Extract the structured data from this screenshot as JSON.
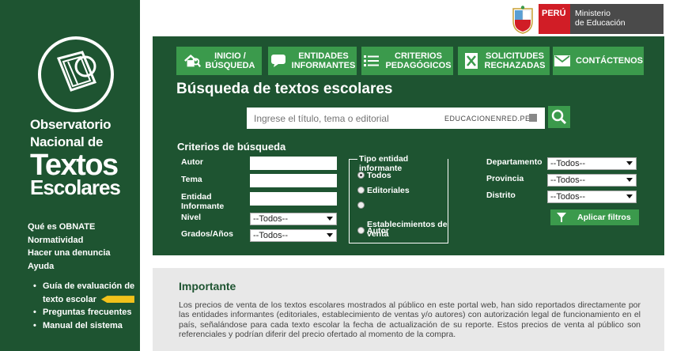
{
  "sidebar": {
    "logo": {
      "line1": "Observatorio",
      "line2": "Nacional de",
      "line3": "Textos",
      "line4": "Escolares"
    },
    "links": [
      {
        "label": "Qué es OBNATE"
      },
      {
        "label": "Normatividad"
      },
      {
        "label": "Hacer una denuncia"
      },
      {
        "label": "Ayuda"
      }
    ],
    "subitems": [
      {
        "label": "Guía de evaluación de"
      },
      {
        "label": "texto escolar"
      },
      {
        "label": "Preguntas frecuentes"
      },
      {
        "label": "Manual del sistema"
      }
    ]
  },
  "header": {
    "country": "PERÚ",
    "ministry_line1": "Ministerio",
    "ministry_line2": "de Educación"
  },
  "nav": [
    {
      "label": "INICIO /\nBÚSQUEDA",
      "icon": "home-search-icon"
    },
    {
      "label": "ENTIDADES\nINFORMANTES",
      "icon": "chat-icon"
    },
    {
      "label": "CRITERIOS\nPEDAGÓGICOS",
      "icon": "list-icon"
    },
    {
      "label": "SOLICITUDES\nRECHAZADAS",
      "icon": "rejected-document-icon"
    },
    {
      "label": "CONTÁCTENOS",
      "icon": "mail-icon"
    }
  ],
  "search": {
    "title": "Búsqueda de textos escolares",
    "placeholder": "Ingrese el título, tema o editorial",
    "watermark": "EDUCACIONENRED.PE"
  },
  "criteria": {
    "title": "Criterios de búsqueda",
    "autor_label": "Autor",
    "tema_label": "Tema",
    "entidad_label": "Entidad\nInformante",
    "nivel_label": "Nivel",
    "nivel_value": "--Todos--",
    "grados_label": "Grados/Años",
    "grados_value": "--Todos--",
    "tipo_legend": "Tipo entidad informante",
    "tipo_options": [
      {
        "label": "Todos"
      },
      {
        "label": "Editoriales"
      },
      {
        "label": "Establecimientos de\nventa"
      },
      {
        "label": "Autor"
      }
    ],
    "departamento_label": "Departamento",
    "departamento_value": "--Todos--",
    "provincia_label": "Provincia",
    "provincia_value": "--Todos--",
    "distrito_label": "Distrito",
    "distrito_value": "--Todos--",
    "apply_label": "Aplicar filtros"
  },
  "important": {
    "title": "Importante",
    "text": "Los precios de venta de los textos escolares mostrados al público en este portal web, han sido reportados directamente por las entidades informantes (editoriales, establecimiento de ventas y/o autores) con autorización legal de funcionamiento en el país, señalándose para cada texto escolar la fecha de actualización de su reporte. Estos precios de venta al público son referenciales y podrían diferir del precio ofertado al momento de la compra."
  },
  "colors": {
    "primary_green": "#1e5431",
    "button_green": "#3b9a4c",
    "peru_red": "#d11d26",
    "accent_yellow": "#f2c21b"
  }
}
